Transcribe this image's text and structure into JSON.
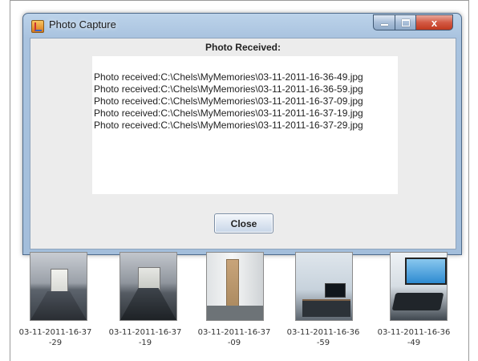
{
  "window": {
    "title": "Photo Capture",
    "icon": "java-app-icon",
    "close_symbol": "x"
  },
  "dialog": {
    "heading": "Photo Received:",
    "log_lines": [
      "Photo received:C:\\Chels\\MyMemories\\03-11-2011-16-36-49.jpg",
      "Photo received:C:\\Chels\\MyMemories\\03-11-2011-16-36-59.jpg",
      "Photo received:C:\\Chels\\MyMemories\\03-11-2011-16-37-09.jpg",
      "Photo received:C:\\Chels\\MyMemories\\03-11-2011-16-37-19.jpg",
      "Photo received:C:\\Chels\\MyMemories\\03-11-2011-16-37-29.jpg"
    ],
    "close_label": "Close"
  },
  "thumbnails": [
    {
      "line1": "03-11-2011-16-37",
      "line2": "-29",
      "scene": "corridor"
    },
    {
      "line1": "03-11-2011-16-37",
      "line2": "-19",
      "scene": "corridor"
    },
    {
      "line1": "03-11-2011-16-37",
      "line2": "-09",
      "scene": "door"
    },
    {
      "line1": "03-11-2011-16-36",
      "line2": "-59",
      "scene": "office"
    },
    {
      "line1": "03-11-2011-16-36",
      "line2": "-49",
      "scene": "desk"
    }
  ],
  "colors": {
    "close_button_red": "#c0391f",
    "title_bar_blue": "#a9c3df"
  }
}
